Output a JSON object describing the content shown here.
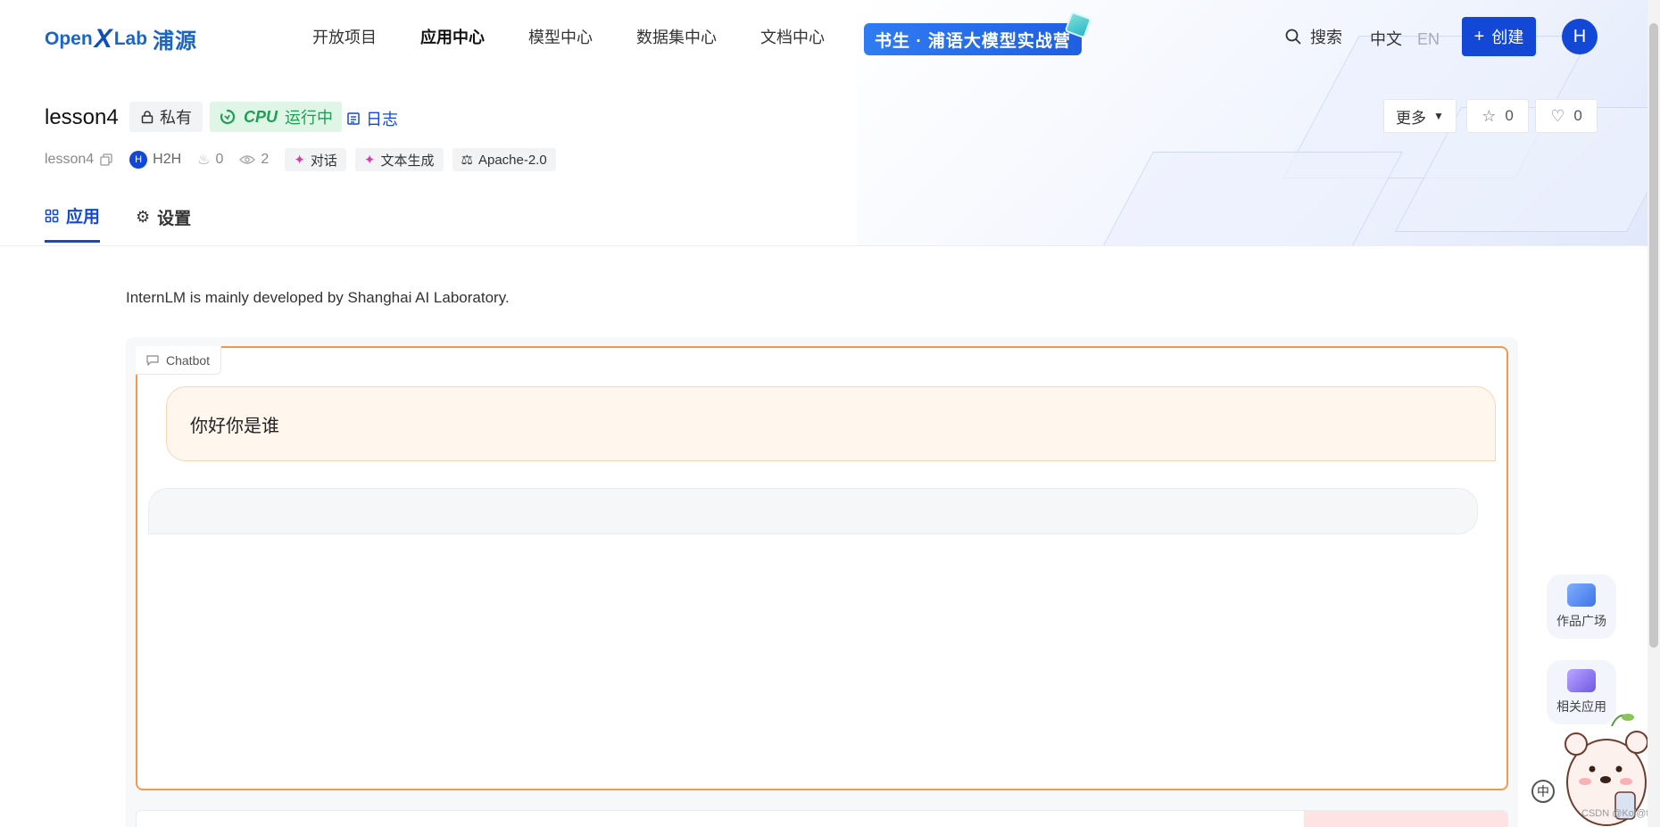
{
  "header": {
    "logo": {
      "open": "Open",
      "x": "X",
      "lab": "Lab",
      "cn": "浦源"
    },
    "nav": [
      {
        "label": "开放项目",
        "active": false
      },
      {
        "label": "应用中心",
        "active": true
      },
      {
        "label": "模型中心",
        "active": false
      },
      {
        "label": "数据集中心",
        "active": false
      },
      {
        "label": "文档中心",
        "active": false
      }
    ],
    "promo_label": "书生 · 浦语大模型实战营",
    "search_label": "搜索",
    "lang_zh": "中文",
    "lang_en": "EN",
    "create_label": "创建",
    "avatar_initial": "H"
  },
  "project": {
    "title": "lesson4",
    "private_label": "私有",
    "cpu_label": "CPU",
    "status_label": "运行中",
    "log_label": "日志",
    "more_label": "更多",
    "star_count": "0",
    "like_count": "0",
    "repo_name": "lesson4",
    "owner_initial": "H",
    "owner": "H2H",
    "hot_count": "0",
    "view_count": "2",
    "tags": [
      "对话",
      "文本生成",
      "Apache-2.0"
    ]
  },
  "tabs": [
    {
      "label": "应用",
      "active": true
    },
    {
      "label": "设置",
      "active": false
    }
  ],
  "app": {
    "description": "InternLM is mainly developed by Shanghai AI Laboratory.",
    "chatbot_label": "Chatbot",
    "messages": [
      {
        "role": "user",
        "text": "你好你是谁"
      },
      {
        "role": "assistant",
        "text": ""
      }
    ]
  },
  "side": {
    "gallery_label": "作品广场",
    "related_label": "相关应用"
  },
  "float_lang": "中",
  "watermark": "CSDN @Kol@t3",
  "colors": {
    "brand": "#1348d6",
    "running_bg": "#dff5e6",
    "running_text": "#1f9d55",
    "chatbot_border": "#f39a4a",
    "user_bubble": "#fff6ee"
  }
}
